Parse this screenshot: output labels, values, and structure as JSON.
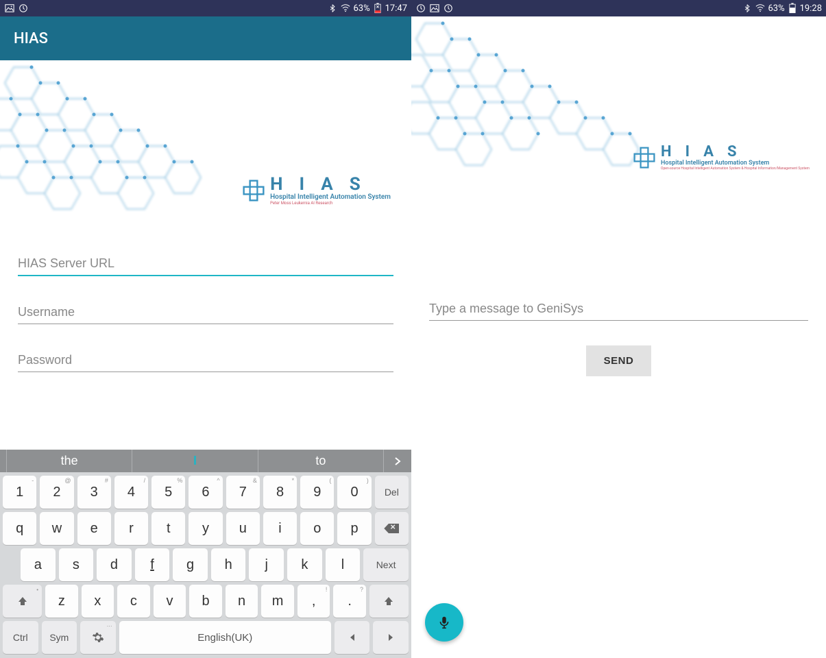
{
  "left": {
    "status": {
      "battery_pct": "63%",
      "time": "17:47"
    },
    "appbar": {
      "title": "HIAS"
    },
    "logo": {
      "letters": "HIAS",
      "subtitle": "Hospital Intelligent Automation System",
      "tiny": "Peter Moss Leukemia AI Research"
    },
    "form": {
      "server_placeholder": "HIAS Server URL",
      "username_placeholder": "Username",
      "password_placeholder": "Password"
    },
    "kbd": {
      "suggest": {
        "a": "the",
        "b": "I",
        "c": "to"
      },
      "numrow": [
        {
          "l": "1",
          "s": "-"
        },
        {
          "l": "2",
          "s": "@"
        },
        {
          "l": "3",
          "s": "#"
        },
        {
          "l": "4",
          "s": "/"
        },
        {
          "l": "5",
          "s": "%"
        },
        {
          "l": "6",
          "s": "^"
        },
        {
          "l": "7",
          "s": "&"
        },
        {
          "l": "8",
          "s": "*"
        },
        {
          "l": "9",
          "s": "("
        },
        {
          "l": "0",
          "s": ")"
        }
      ],
      "del": "Del",
      "rowQ": [
        "q",
        "w",
        "e",
        "r",
        "t",
        "y",
        "u",
        "i",
        "o",
        "p"
      ],
      "rowA": [
        "a",
        "s",
        "d",
        "f",
        "g",
        "h",
        "j",
        "k",
        "l"
      ],
      "next": "Next",
      "rowZ": [
        "z",
        "x",
        "c",
        "v",
        "b",
        "n",
        "m"
      ],
      "comma": ",",
      "comma_s": "!",
      "period": ".",
      "period_s": "?",
      "ctrl": "Ctrl",
      "sym": "Sym",
      "space": "English(UK)"
    }
  },
  "right": {
    "status": {
      "battery_pct": "63%",
      "time": "19:28"
    },
    "logo": {
      "letters": "HIAS",
      "subtitle": "Hospital Intelligent Automation System",
      "tiny": "Open-source Hospital Intelligent Automation System & Hospital Information/Management System"
    },
    "form": {
      "message_placeholder": "Type a message to GeniSys",
      "send_label": "SEND"
    }
  }
}
